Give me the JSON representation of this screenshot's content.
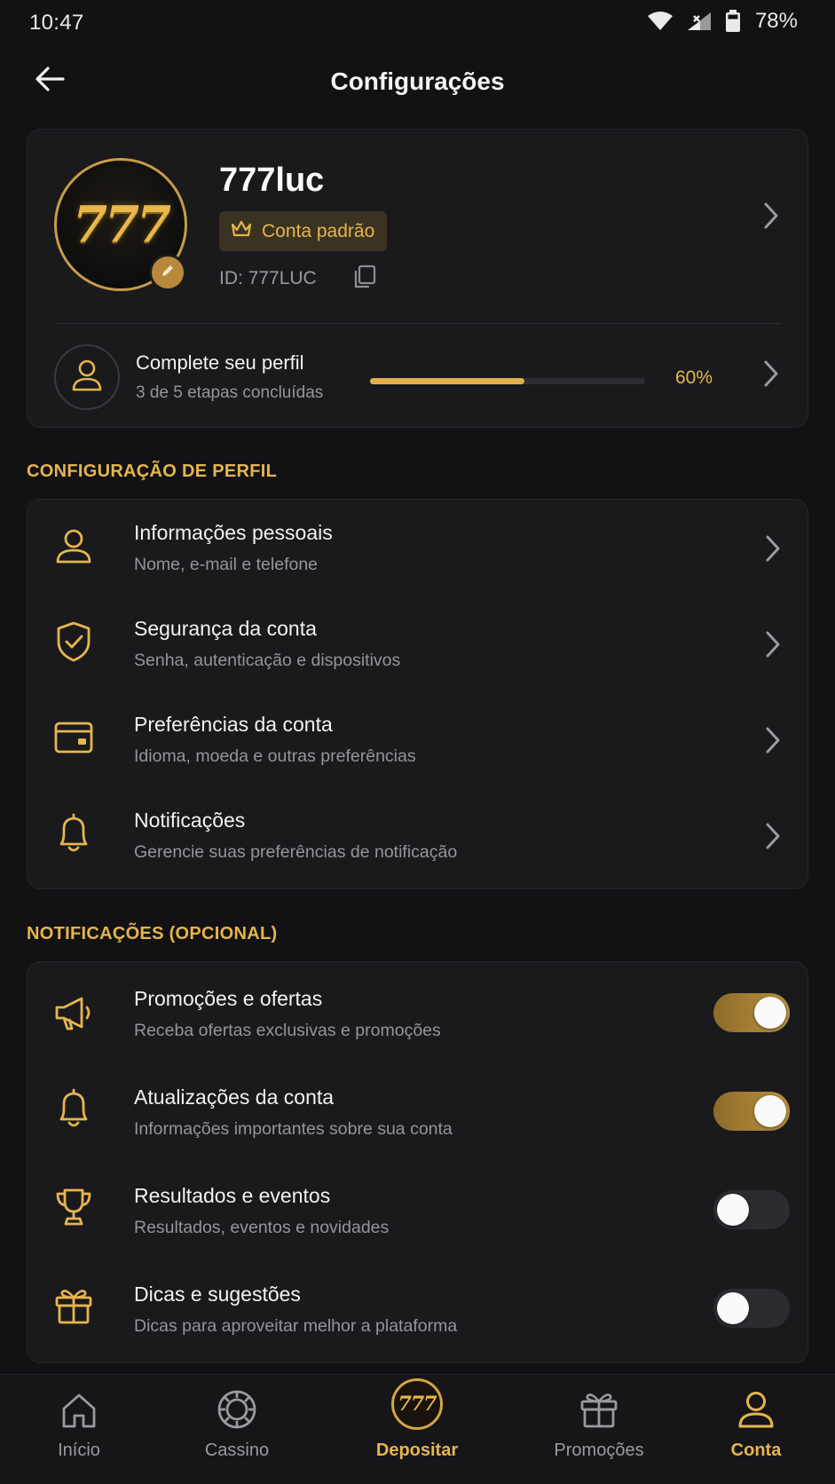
{
  "status_bar": {
    "time": "10:47",
    "battery": "78%"
  },
  "header": {
    "title": "Configurações"
  },
  "profile": {
    "avatar_logo": "777",
    "username": "777luc",
    "badge": "Conta padrão",
    "id_text": "ID: 777LUC",
    "completion": {
      "title": "Complete seu perfil",
      "subtitle": "3 de 5 etapas concluídas",
      "percent_label": "60%",
      "progress": 0.56
    }
  },
  "profile_section": {
    "title": "CONFIGURAÇÃO DE PERFIL",
    "items": [
      {
        "title": "Informações pessoais",
        "subtitle": "Nome, e-mail e telefone",
        "icon": "user-icon"
      },
      {
        "title": "Segurança da conta",
        "subtitle": "Senha, autenticação e dispositivos",
        "icon": "shield-check-icon"
      },
      {
        "title": "Preferências da conta",
        "subtitle": "Idioma, moeda e outras preferências",
        "icon": "wallet-icon"
      },
      {
        "title": "Notificações",
        "subtitle": "Gerencie suas preferências de notificação",
        "icon": "bell-icon"
      }
    ]
  },
  "notifications_section": {
    "title": "NOTIFICAÇÕES (OPCIONAL)",
    "items": [
      {
        "title": "Promoções e ofertas",
        "subtitle": "Receba ofertas exclusivas e promoções",
        "icon": "megaphone-icon",
        "enabled": true
      },
      {
        "title": "Atualizações da conta",
        "subtitle": "Informações importantes sobre sua conta",
        "icon": "bell-icon",
        "enabled": true
      },
      {
        "title": "Resultados e eventos",
        "subtitle": "Resultados, eventos e novidades",
        "icon": "trophy-icon",
        "enabled": false
      },
      {
        "title": "Dicas e sugestões",
        "subtitle": "Dicas para aproveitar melhor a plataforma",
        "icon": "gift-icon",
        "enabled": false
      }
    ]
  },
  "bottom_nav": {
    "items": [
      {
        "label": "Início",
        "icon": "home-icon"
      },
      {
        "label": "Cassino",
        "icon": "chip-icon"
      },
      {
        "label": "Depositar",
        "icon": "deposit-777-icon",
        "badge": "777"
      },
      {
        "label": "Promoções",
        "icon": "gift-icon"
      },
      {
        "label": "Conta",
        "icon": "user-icon",
        "active": true
      }
    ]
  },
  "colors": {
    "accent": "#e6b54c",
    "background": "#121214",
    "card": "#1a1a1d",
    "muted_text": "#95959a"
  }
}
